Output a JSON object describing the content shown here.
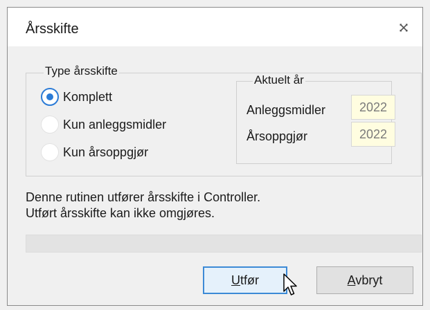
{
  "dialog": {
    "title": "Årsskifte",
    "close_icon": "close-icon"
  },
  "type_group": {
    "legend": "Type årsskifte",
    "options": [
      {
        "label": "Komplett",
        "checked": true
      },
      {
        "label": "Kun anleggsmidler",
        "checked": false
      },
      {
        "label": "Kun årsoppgjør",
        "checked": false
      }
    ]
  },
  "year_group": {
    "legend": "Aktuelt år",
    "fields": [
      {
        "label": "Anleggsmidler",
        "value": "2022"
      },
      {
        "label": "Årsoppgjør",
        "value": "2022"
      }
    ]
  },
  "description": {
    "line1": "Denne rutinen utfører årsskifte i Controller.",
    "line2": "Utført årsskifte kan ikke omgjøres."
  },
  "buttons": {
    "execute": {
      "mnemonic": "U",
      "rest": "tfør"
    },
    "cancel": {
      "mnemonic": "A",
      "rest": "vbryt"
    }
  },
  "colors": {
    "accent": "#2b7bd6",
    "field_background": "#fffde0"
  }
}
